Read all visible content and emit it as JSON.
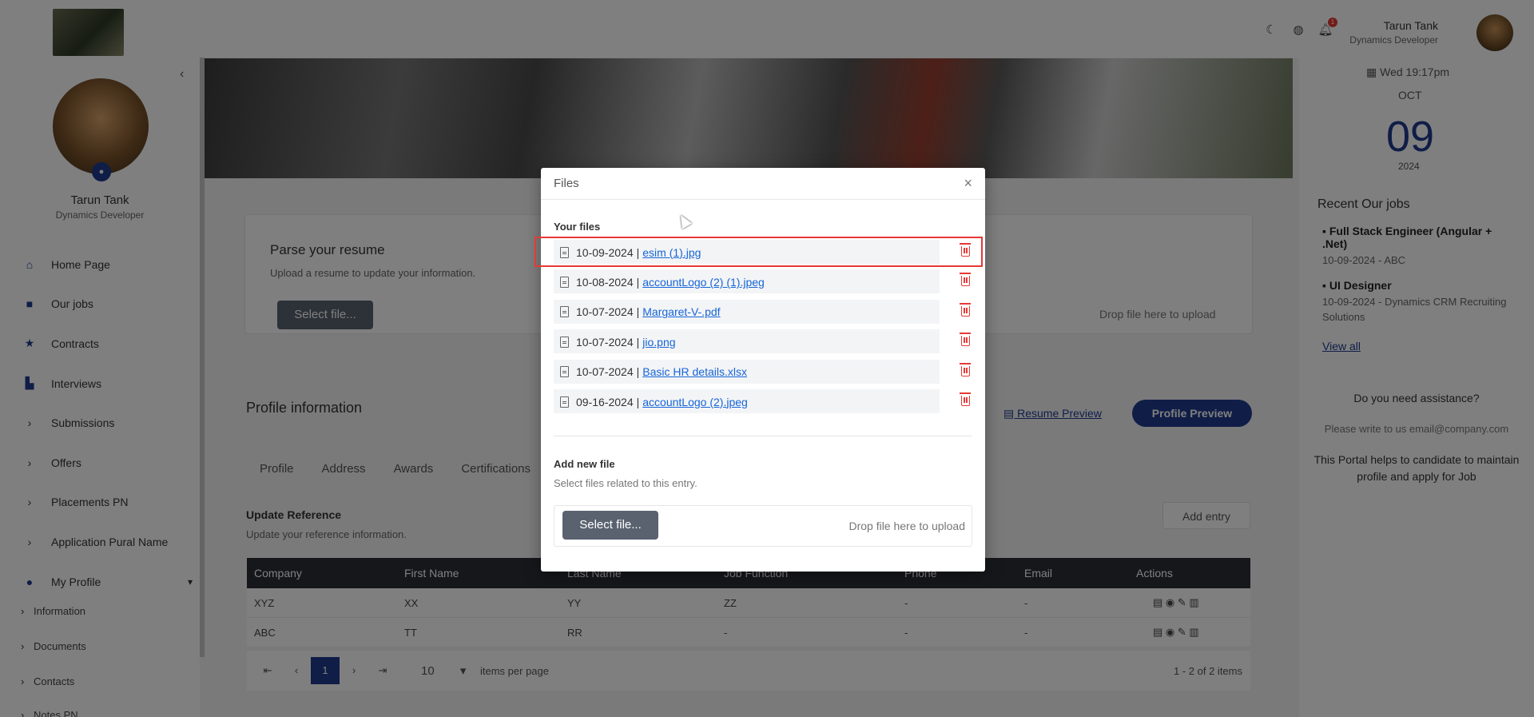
{
  "user": {
    "name": "Tarun Tank",
    "role": "Dynamics Developer"
  },
  "nav": [
    {
      "label": "Home Page",
      "icon": "home-icon"
    },
    {
      "label": "Our jobs",
      "icon": "briefcase-icon"
    },
    {
      "label": "Contracts",
      "icon": "star-icon"
    },
    {
      "label": "Interviews",
      "icon": "chart-icon"
    },
    {
      "label": "Submissions",
      "icon": "chevron-right-icon"
    },
    {
      "label": "Offers",
      "icon": "chevron-right-icon"
    },
    {
      "label": "Placements PN",
      "icon": "chevron-right-icon"
    },
    {
      "label": "Application Pural Name",
      "icon": "chevron-right-icon"
    },
    {
      "label": "My Profile",
      "icon": "user-icon"
    }
  ],
  "subnav": [
    "Information",
    "Documents",
    "Contacts",
    "Notes PN"
  ],
  "parse": {
    "title": "Parse your resume",
    "subtitle": "Upload a resume to update your information.",
    "button": "Select file...",
    "drop": "Drop file here to upload"
  },
  "profile": {
    "title": "Profile information",
    "resume_preview": "Resume Preview",
    "profile_preview": "Profile Preview",
    "tabs": [
      "Profile",
      "Address",
      "Awards",
      "Certifications"
    ],
    "section_title": "Update Reference",
    "section_sub": "Update your reference information.",
    "add_entry": "Add entry"
  },
  "grid": {
    "headers": [
      "Company",
      "First Name",
      "Last Name",
      "Job Function",
      "Phone",
      "Email",
      "Actions"
    ],
    "rows": [
      [
        "XYZ",
        "XX",
        "YY",
        "ZZ",
        "-",
        "-"
      ],
      [
        "ABC",
        "TT",
        "RR",
        "-",
        "-",
        "-"
      ]
    ],
    "page": "1",
    "page_size": "10",
    "items_per_page": "items per page",
    "summary": "1 - 2 of 2 items"
  },
  "right": {
    "date": "Wed 19:17pm",
    "month": "OCT",
    "day": "09",
    "year": "2024",
    "jobs_title": "Recent Our jobs",
    "jobs": [
      {
        "title": "Full Stack Engineer (Angular + .Net)",
        "meta": "10-09-2024 - ABC"
      },
      {
        "title": "UI Designer",
        "meta": "10-09-2024 - Dynamics CRM Recruiting Solutions"
      }
    ],
    "view_all": "View all",
    "assist": "Do you need assistance?",
    "email": "Please write to us email@company.com",
    "portal": "This Portal helps to candidate to maintain profile and apply for Job"
  },
  "modal": {
    "title": "Files",
    "close": "×",
    "your_files": "Your files",
    "files": [
      {
        "date": "10-09-2024",
        "name": "esim (1).jpg"
      },
      {
        "date": "10-08-2024",
        "name": "accountLogo (2) (1).jpeg"
      },
      {
        "date": "10-07-2024",
        "name": "Margaret-V-.pdf"
      },
      {
        "date": "10-07-2024",
        "name": "jio.png"
      },
      {
        "date": "10-07-2024",
        "name": "Basic HR details.xlsx"
      },
      {
        "date": "09-16-2024",
        "name": "accountLogo (2).jpeg"
      }
    ],
    "add_new": "Add new file",
    "add_sub": "Select files related to this entry.",
    "select_button": "Select file...",
    "drop": "Drop file here to upload"
  }
}
